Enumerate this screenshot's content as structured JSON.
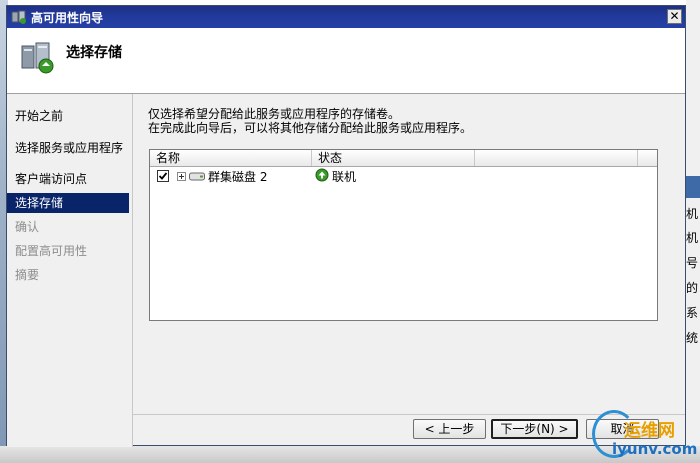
{
  "window": {
    "title": "高可用性向导",
    "close_glyph": "✕"
  },
  "header": {
    "title": "选择存储"
  },
  "sidebar": {
    "items": [
      {
        "label": "开始之前",
        "state": "normal"
      },
      {
        "label": "选择服务或应用程序",
        "state": "normal"
      },
      {
        "label": "客户端访问点",
        "state": "normal"
      },
      {
        "label": "选择存储",
        "state": "active"
      },
      {
        "label": "确认",
        "state": "disabled"
      },
      {
        "label": "配置高可用性",
        "state": "disabled"
      },
      {
        "label": "摘要",
        "state": "disabled"
      }
    ]
  },
  "content": {
    "description_line1": "仅选择希望分配给此服务或应用程序的存储卷。",
    "description_line2": "在完成此向导后，可以将其他存储分配给此服务或应用程序。",
    "table": {
      "columns": [
        "名称",
        "状态",
        ""
      ],
      "rows": [
        {
          "checked": true,
          "name": "群集磁盘 2",
          "status": "联机"
        }
      ]
    }
  },
  "buttons": {
    "prev": "< 上一步",
    "next": "下一步(N) >",
    "cancel": "取消"
  },
  "background": {
    "right_texts": [
      "机",
      "机",
      "号",
      "的",
      "系",
      "统"
    ]
  },
  "watermark": {
    "cn": "运维网",
    "en": "iyunv.com"
  },
  "colors": {
    "titlebar": "#223a9c",
    "selection": "#0a246a",
    "status_online": "#3a9a2a"
  }
}
